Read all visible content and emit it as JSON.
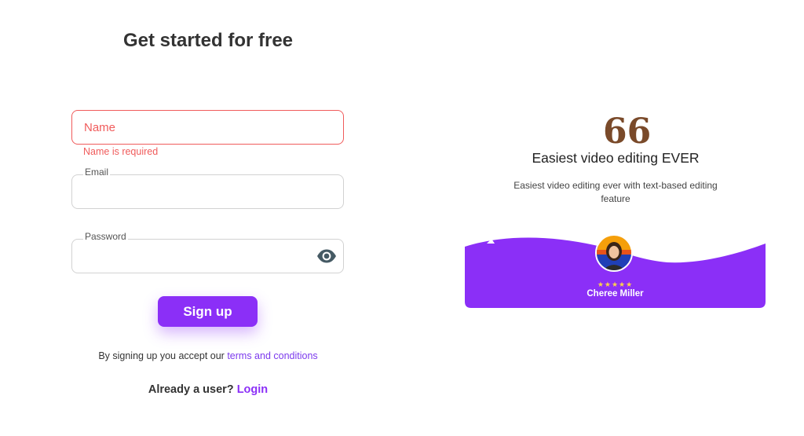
{
  "signup_form": {
    "title": "Get started for free",
    "name_placeholder": "Name",
    "name_error": "Name is required",
    "email_label": "Email",
    "password_label": "Password",
    "signup_label": "Sign up",
    "terms_prefix": "By signing up you accept our",
    "terms_link": "terms and conditions",
    "login_prefix": "Already a user?",
    "login_link": "Login"
  },
  "testimonial": {
    "quote_mark": "66",
    "title": "Easiest video editing EVER",
    "text": "Easiest video editing ever with text-based editing feature",
    "rating_stars": 5,
    "stars_text": "★★★★★",
    "author": "Cheree Miller"
  },
  "colors": {
    "accent": "#8b2ff7",
    "error": "#f05b5b",
    "link": "#7c3aed"
  },
  "icons": {
    "password_toggle": "eye-icon",
    "quote": "quote-icon",
    "rating": "star-icon"
  }
}
